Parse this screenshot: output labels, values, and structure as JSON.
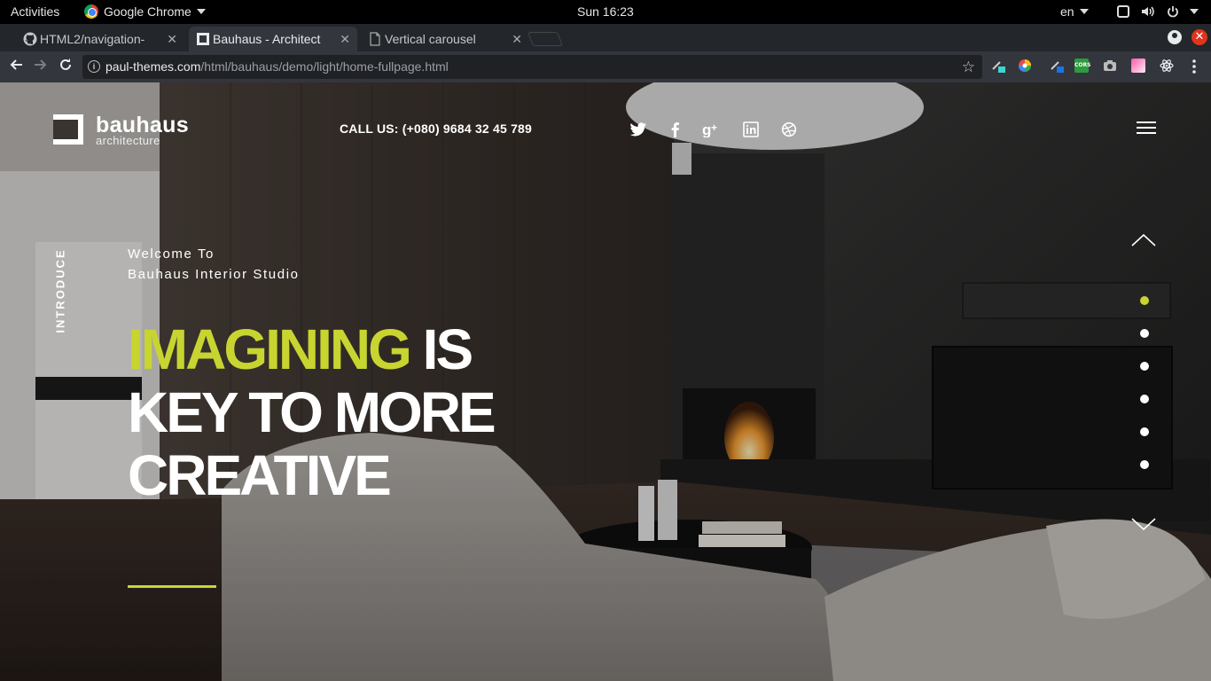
{
  "system_bar": {
    "activities": "Activities",
    "app_name": "Google Chrome",
    "clock": "Sun 16:23",
    "language": "en"
  },
  "tabs": [
    {
      "title": "HTML2/navigation-",
      "icon": "github-icon"
    },
    {
      "title": "Bauhaus - Architect",
      "icon": "bauhaus-icon",
      "active": true
    },
    {
      "title": "Vertical carousel",
      "icon": "document-icon"
    }
  ],
  "address_bar": {
    "host": "paul-themes.com",
    "path": "/html/bauhaus/demo/light/home-fullpage.html"
  },
  "site": {
    "logo": {
      "name": "bauhaus",
      "subtitle": "architecture"
    },
    "call_us": "CALL US: (+080) 9684 32 45 789",
    "social": [
      "twitter-icon",
      "facebook-icon",
      "google-plus-icon",
      "linkedin-icon",
      "dribbble-icon"
    ],
    "section_label": "INTRODUCE",
    "welcome_line1": "Welcome To",
    "welcome_line2": "Bauhaus Interior Studio",
    "headline": {
      "accent": "IMAGINING",
      "rest1": " IS",
      "line2": "KEY TO MORE",
      "line3": "CREATIVE"
    },
    "slides": {
      "count": 6,
      "active_index": 0
    },
    "colors": {
      "accent": "#c8d430",
      "text": "#ffffff"
    }
  }
}
